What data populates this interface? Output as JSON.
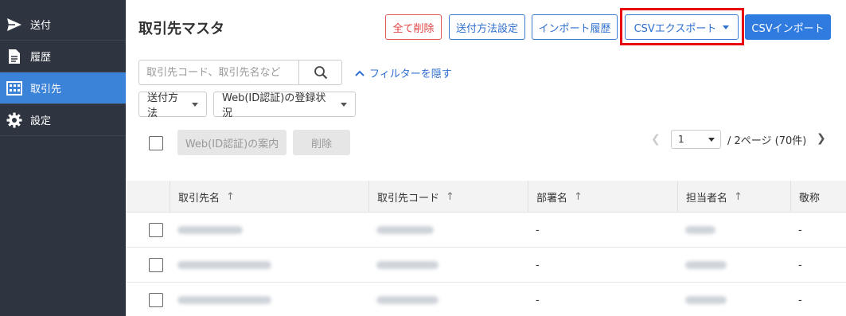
{
  "sidebar": {
    "items": [
      {
        "label": "送付",
        "icon": "send-icon"
      },
      {
        "label": "履歴",
        "icon": "document-icon"
      },
      {
        "label": "取引先",
        "icon": "building-icon"
      },
      {
        "label": "設定",
        "icon": "gear-icon"
      }
    ],
    "active": "取引先"
  },
  "header": {
    "title": "取引先マスタ",
    "delete_all": "全て削除",
    "send_method_settings": "送付方法設定",
    "import_history": "インポート履歴",
    "csv_export": "CSVエクスポート",
    "csv_import": "CSVインポート"
  },
  "search": {
    "placeholder": "取引先コード、取引先名など",
    "value": "",
    "filter_toggle": "フィルターを隠す"
  },
  "filters": {
    "send_method": "送付方法",
    "web_registration": "Web(ID認証)の登録状況"
  },
  "actions": {
    "web_guide": "Web(ID認証)の案内",
    "delete": "削除"
  },
  "pagination": {
    "current_page": "1",
    "summary": "/  2ページ (70件)"
  },
  "table": {
    "columns": [
      "取引先名",
      "取引先コード",
      "部署名",
      "担当者名",
      "敬称"
    ],
    "rows": [
      {
        "department": "-",
        "honorific": "-"
      },
      {
        "department": "-",
        "honorific": "-"
      },
      {
        "department": "-",
        "honorific": "-"
      }
    ]
  },
  "colors": {
    "sidebar_bg": "#2f3540",
    "active_item": "#3b82d9",
    "primary": "#2f7be0",
    "danger": "#e04040",
    "highlight": "#e8000e"
  }
}
